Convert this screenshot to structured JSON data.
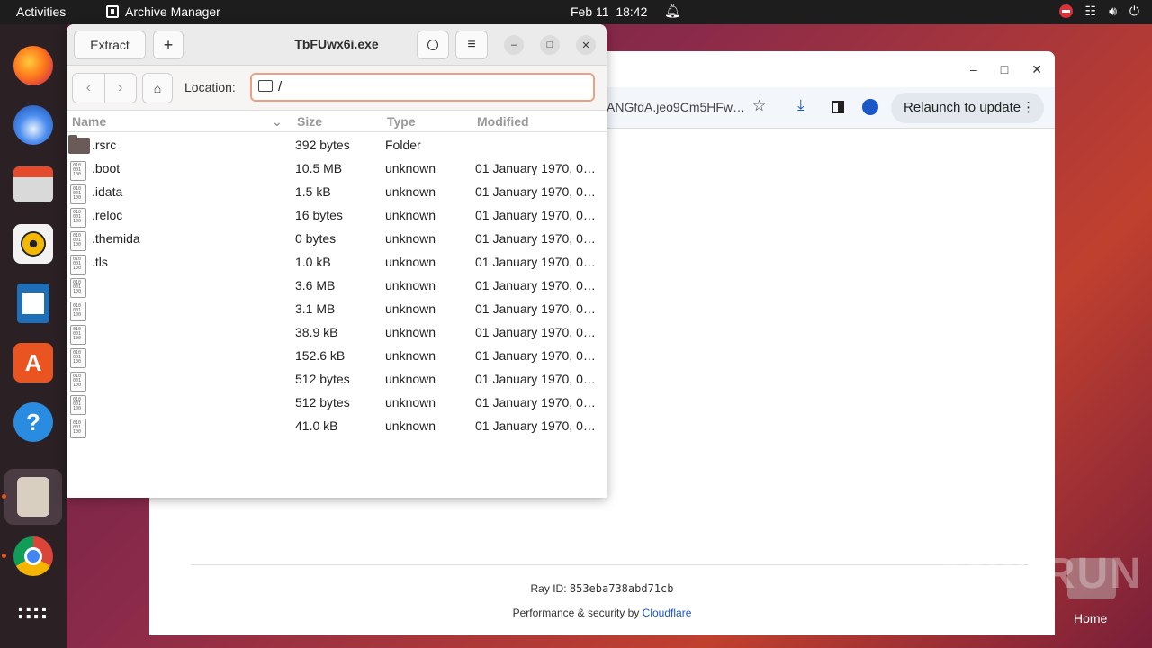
{
  "topbar": {
    "activities": "Activities",
    "app_name": "Archive Manager",
    "date": "Feb 11",
    "time": "18:42"
  },
  "dock": {
    "items": [
      "firefox-icon",
      "thunderbird-icon",
      "files-icon",
      "rhythmbox-icon",
      "writer-icon",
      "app-center-icon",
      "help-icon",
      "archive-manager-icon",
      "chrome-icon",
      "show-apps-icon"
    ]
  },
  "chrome": {
    "url": "ANGfdA.jeo9Cm5HFw…",
    "relaunch_label": "Relaunch to update",
    "ray_label": "Ray ID:",
    "ray_id": "853eba738abd71cb",
    "perf_text": "Performance & security by",
    "perf_link": "Cloudflare"
  },
  "desktop": {
    "home_label": "Home",
    "watermark": "ANY RUN"
  },
  "archive": {
    "title": "TbFUwx6i.exe",
    "extract_label": "Extract",
    "add_label": "+",
    "location_label": "Location:",
    "location_value": "/",
    "columns": {
      "name": "Name",
      "size": "Size",
      "type": "Type",
      "modified": "Modified"
    },
    "rows": [
      {
        "name": ".rsrc",
        "size": "392 bytes",
        "type": "Folder",
        "modified": "",
        "kind": "folder"
      },
      {
        "name": ".boot",
        "size": "10.5 MB",
        "type": "unknown",
        "modified": "01 January 1970, 0…",
        "kind": "file"
      },
      {
        "name": ".idata",
        "size": "1.5 kB",
        "type": "unknown",
        "modified": "01 January 1970, 0…",
        "kind": "file"
      },
      {
        "name": ".reloc",
        "size": "16 bytes",
        "type": "unknown",
        "modified": "01 January 1970, 0…",
        "kind": "file"
      },
      {
        "name": ".themida",
        "size": "0 bytes",
        "type": "unknown",
        "modified": "01 January 1970, 0…",
        "kind": "file"
      },
      {
        "name": ".tls",
        "size": "1.0 kB",
        "type": "unknown",
        "modified": "01 January 1970, 0…",
        "kind": "file"
      },
      {
        "name": "",
        "size": "3.6 MB",
        "type": "unknown",
        "modified": "01 January 1970, 0…",
        "kind": "file"
      },
      {
        "name": "",
        "size": "3.1 MB",
        "type": "unknown",
        "modified": "01 January 1970, 0…",
        "kind": "file"
      },
      {
        "name": "",
        "size": "38.9 kB",
        "type": "unknown",
        "modified": "01 January 1970, 0…",
        "kind": "file"
      },
      {
        "name": "",
        "size": "152.6 kB",
        "type": "unknown",
        "modified": "01 January 1970, 0…",
        "kind": "file"
      },
      {
        "name": "",
        "size": "512 bytes",
        "type": "unknown",
        "modified": "01 January 1970, 0…",
        "kind": "file"
      },
      {
        "name": "",
        "size": "512 bytes",
        "type": "unknown",
        "modified": "01 January 1970, 0…",
        "kind": "file"
      },
      {
        "name": "",
        "size": "41.0 kB",
        "type": "unknown",
        "modified": "01 January 1970, 0…",
        "kind": "file"
      }
    ]
  }
}
